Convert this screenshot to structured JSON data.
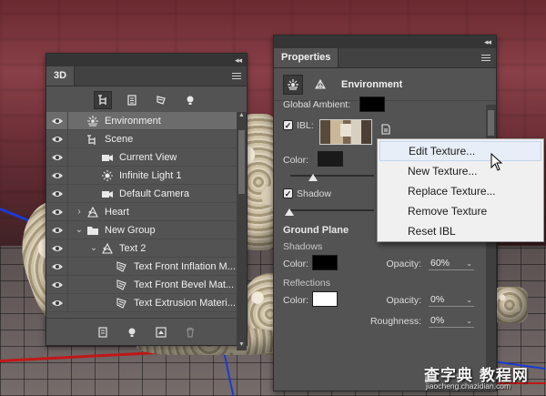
{
  "panel3d": {
    "tab_title": "3D",
    "topbar_collapse": "◂◂",
    "topbar_close": "✕",
    "filter_buttons": [
      "whole-scene-filter",
      "meshes-filter",
      "materials-filter",
      "lights-filter"
    ],
    "layers": [
      {
        "name": "Environment",
        "indent": 0,
        "twisty": "",
        "icon": "environment-icon",
        "selected": true
      },
      {
        "name": "Scene",
        "indent": 0,
        "twisty": "",
        "icon": "scene-icon",
        "selected": false
      },
      {
        "name": "Current View",
        "indent": 1,
        "twisty": "",
        "icon": "camera-icon",
        "selected": false
      },
      {
        "name": "Infinite Light 1",
        "indent": 1,
        "twisty": "",
        "icon": "light-icon",
        "selected": false
      },
      {
        "name": "Default Camera",
        "indent": 1,
        "twisty": "",
        "icon": "camera-icon",
        "selected": false
      },
      {
        "name": "Heart",
        "indent": 0,
        "twisty": "›",
        "icon": "mesh-icon",
        "selected": false
      },
      {
        "name": "New Group",
        "indent": 0,
        "twisty": "⌄",
        "icon": "group-icon",
        "selected": false
      },
      {
        "name": "Text 2",
        "indent": 1,
        "twisty": "⌄",
        "icon": "mesh-icon",
        "selected": false
      },
      {
        "name": "Text Front Inflation M...",
        "indent": 2,
        "twisty": "",
        "icon": "material-icon",
        "selected": false
      },
      {
        "name": "Text Front Bevel Mat...",
        "indent": 2,
        "twisty": "",
        "icon": "material-icon",
        "selected": false
      },
      {
        "name": "Text Extrusion Materi...",
        "indent": 2,
        "twisty": "",
        "icon": "material-icon",
        "selected": false
      }
    ],
    "bottom_buttons": [
      "add-mesh-button",
      "add-light-button",
      "render-button",
      "delete-button"
    ]
  },
  "properties": {
    "tab_title": "Properties",
    "section_title": "Environment",
    "global_ambient_label": "Global Ambient:",
    "ibl_label": "IBL:",
    "ibl_checked": true,
    "color_label": "Color:",
    "shadow_label": "Shadow",
    "shadow_checked": true,
    "ground_plane_title": "Ground Plane",
    "shadows_sub": "Shadows",
    "shadows_color_label": "Color:",
    "shadows_opacity_label": "Opacity:",
    "shadows_opacity_value": "60%",
    "reflections_sub": "Reflections",
    "reflections_color_label": "Color:",
    "reflections_opacity_label": "Opacity:",
    "reflections_opacity_value": "0%",
    "roughness_label": "Roughness:",
    "roughness_value": "0%",
    "colors": {
      "global_ambient": "#000000",
      "ibl_color": "#1a1a1a",
      "shadows_color": "#000000",
      "reflections_color": "#ffffff"
    }
  },
  "context_menu": {
    "items": [
      {
        "label": "Edit Texture...",
        "hover": true
      },
      {
        "label": "New Texture...",
        "hover": false
      },
      {
        "label": "Replace Texture...",
        "hover": false
      },
      {
        "label": "Remove Texture",
        "hover": false
      },
      {
        "label": "Reset IBL",
        "hover": false
      }
    ]
  },
  "watermark": {
    "main": "查字典 教程网",
    "sub": "jiaocheng.chazidian.com"
  }
}
